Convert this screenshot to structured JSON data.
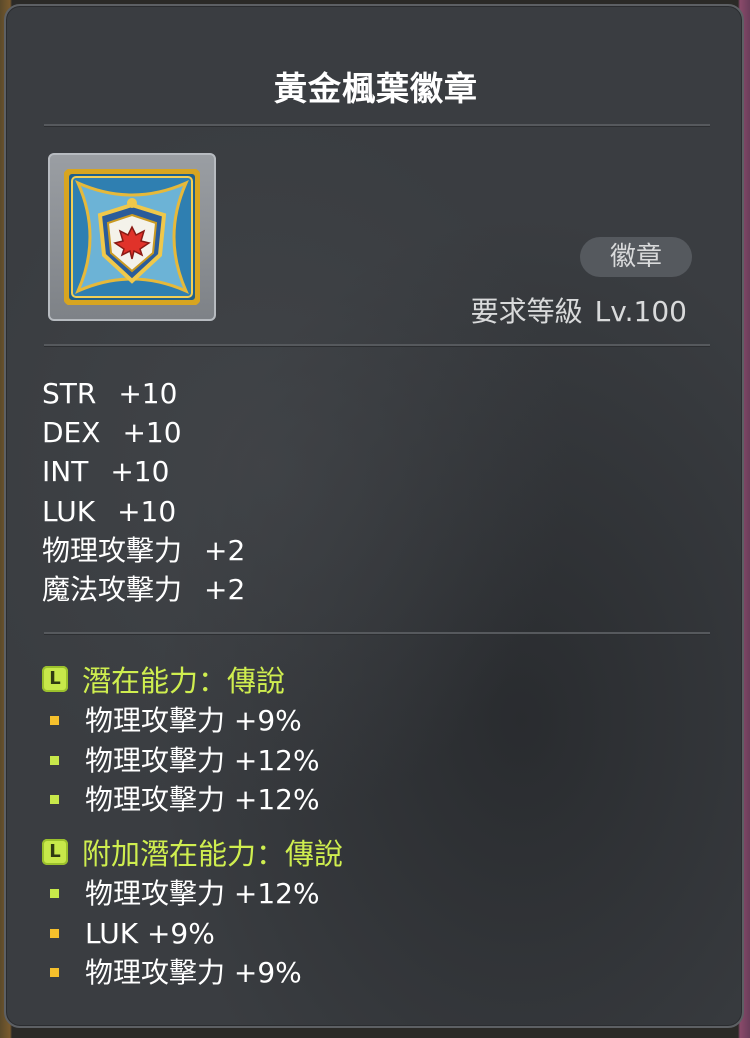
{
  "item": {
    "name": "黃金楓葉徽章",
    "category": "徽章",
    "required_level_label": "要求等級",
    "required_level_value": "Lv.100",
    "icon": "golden-maple-emblem-icon"
  },
  "stats": [
    {
      "name": "STR",
      "value": "+10"
    },
    {
      "name": "DEX",
      "value": "+10"
    },
    {
      "name": "INT",
      "value": "+10"
    },
    {
      "name": "LUK",
      "value": "+10"
    },
    {
      "name": "物理攻擊力",
      "value": "+2"
    },
    {
      "name": "魔法攻擊力",
      "value": "+2"
    }
  ],
  "potential": {
    "grade_letter": "L",
    "title": "潛在能力：傳說",
    "lines": [
      {
        "text": "物理攻擊力 +9%",
        "tier": "unique"
      },
      {
        "text": "物理攻擊力 +12%",
        "tier": "legendary"
      },
      {
        "text": "物理攻擊力 +12%",
        "tier": "legendary"
      }
    ]
  },
  "bonus_potential": {
    "grade_letter": "L",
    "title": "附加潛在能力：傳說",
    "lines": [
      {
        "text": "物理攻擊力 +12%",
        "tier": "legendary"
      },
      {
        "text": "LUK +9%",
        "tier": "unique"
      },
      {
        "text": "物理攻擊力 +9%",
        "tier": "unique"
      }
    ]
  },
  "colors": {
    "legendary_accent": "#cfee4f",
    "unique_bullet": "#f5c02c",
    "legendary_bullet": "#c7e84a",
    "panel_background": "#3a3d41"
  }
}
